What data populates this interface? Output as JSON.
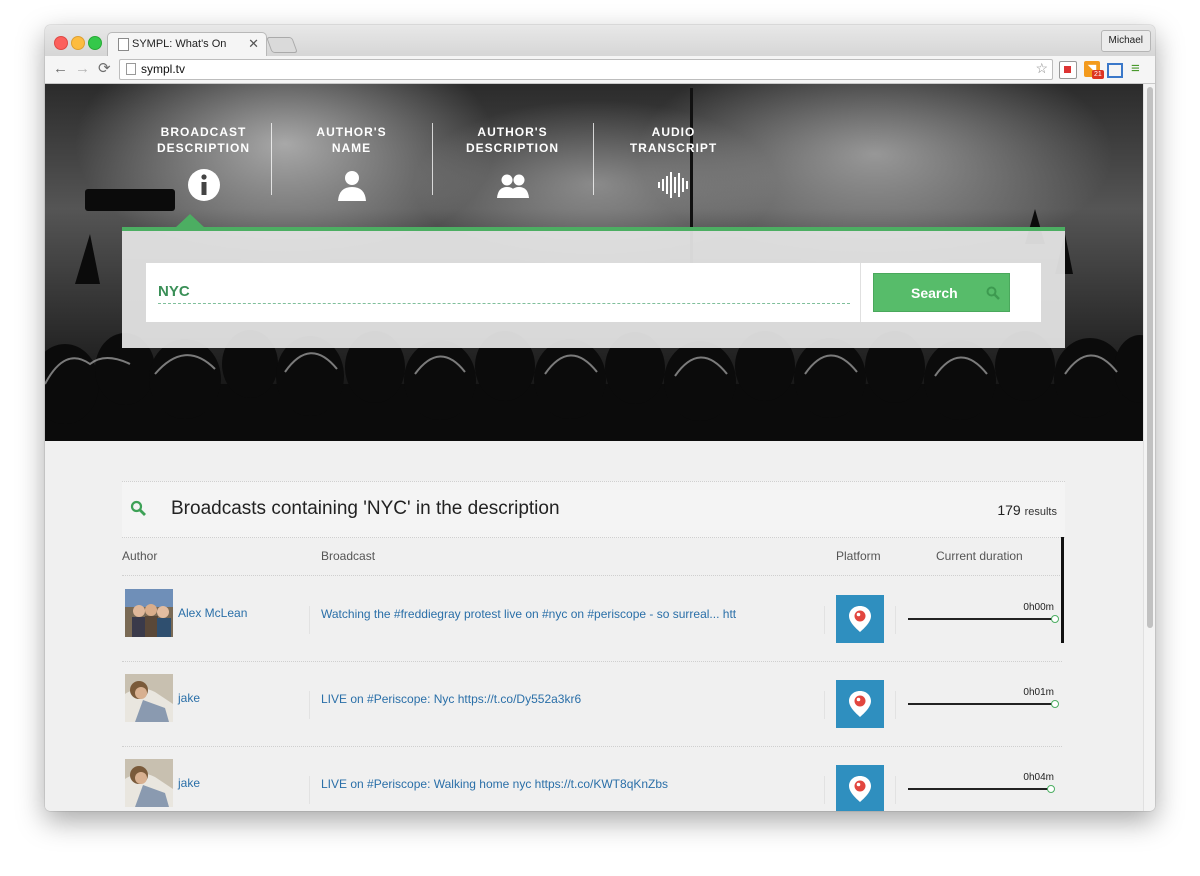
{
  "browser": {
    "tab_title": "SYMPL: What's On",
    "tab_close": "✕",
    "profile_name": "Michael",
    "url": "sympl.tv",
    "back_glyph": "←",
    "forward_glyph": "→",
    "reload_glyph": "⟳",
    "star_glyph": "☆",
    "menu_glyph": "≡",
    "rss_glyph": "◥",
    "extension_badge": "21"
  },
  "filter_tabs": [
    {
      "label_line1": "BROADCAST",
      "label_line2": "DESCRIPTION",
      "icon": "info-icon",
      "active": true
    },
    {
      "label_line1": "AUTHOR'S",
      "label_line2": "NAME",
      "icon": "user-icon",
      "active": false
    },
    {
      "label_line1": "AUTHOR'S",
      "label_line2": "DESCRIPTION",
      "icon": "users-icon",
      "active": false
    },
    {
      "label_line1": "AUDIO",
      "label_line2": "TRANSCRIPT",
      "icon": "audio-wave-icon",
      "active": false
    }
  ],
  "search": {
    "value": "NYC",
    "button_label": "Search"
  },
  "results": {
    "title": "Broadcasts containing 'NYC' in the description",
    "count": "179",
    "count_suffix": "results",
    "columns": {
      "author": "Author",
      "broadcast": "Broadcast",
      "platform": "Platform",
      "duration": "Current duration"
    },
    "rows": [
      {
        "author": "Alex McLean",
        "broadcast": "Watching the #freddiegray protest live on #nyc on #periscope - so surreal... htt",
        "platform": "periscope-icon",
        "duration": "0h00m",
        "progress": 1.0
      },
      {
        "author": "jake",
        "broadcast": "LIVE on #Periscope: Nyc https://t.co/Dy552a3kr6",
        "platform": "periscope-icon",
        "duration": "0h01m",
        "progress": 1.0
      },
      {
        "author": "jake",
        "broadcast": "LIVE on #Periscope: Walking home nyc https://t.co/KWT8qKnZbs",
        "platform": "periscope-icon",
        "duration": "0h04m",
        "progress": 0.97
      }
    ]
  },
  "colors": {
    "accent": "#4cae62",
    "link": "#2a6fa8",
    "periscope": "#2f8fbf"
  }
}
